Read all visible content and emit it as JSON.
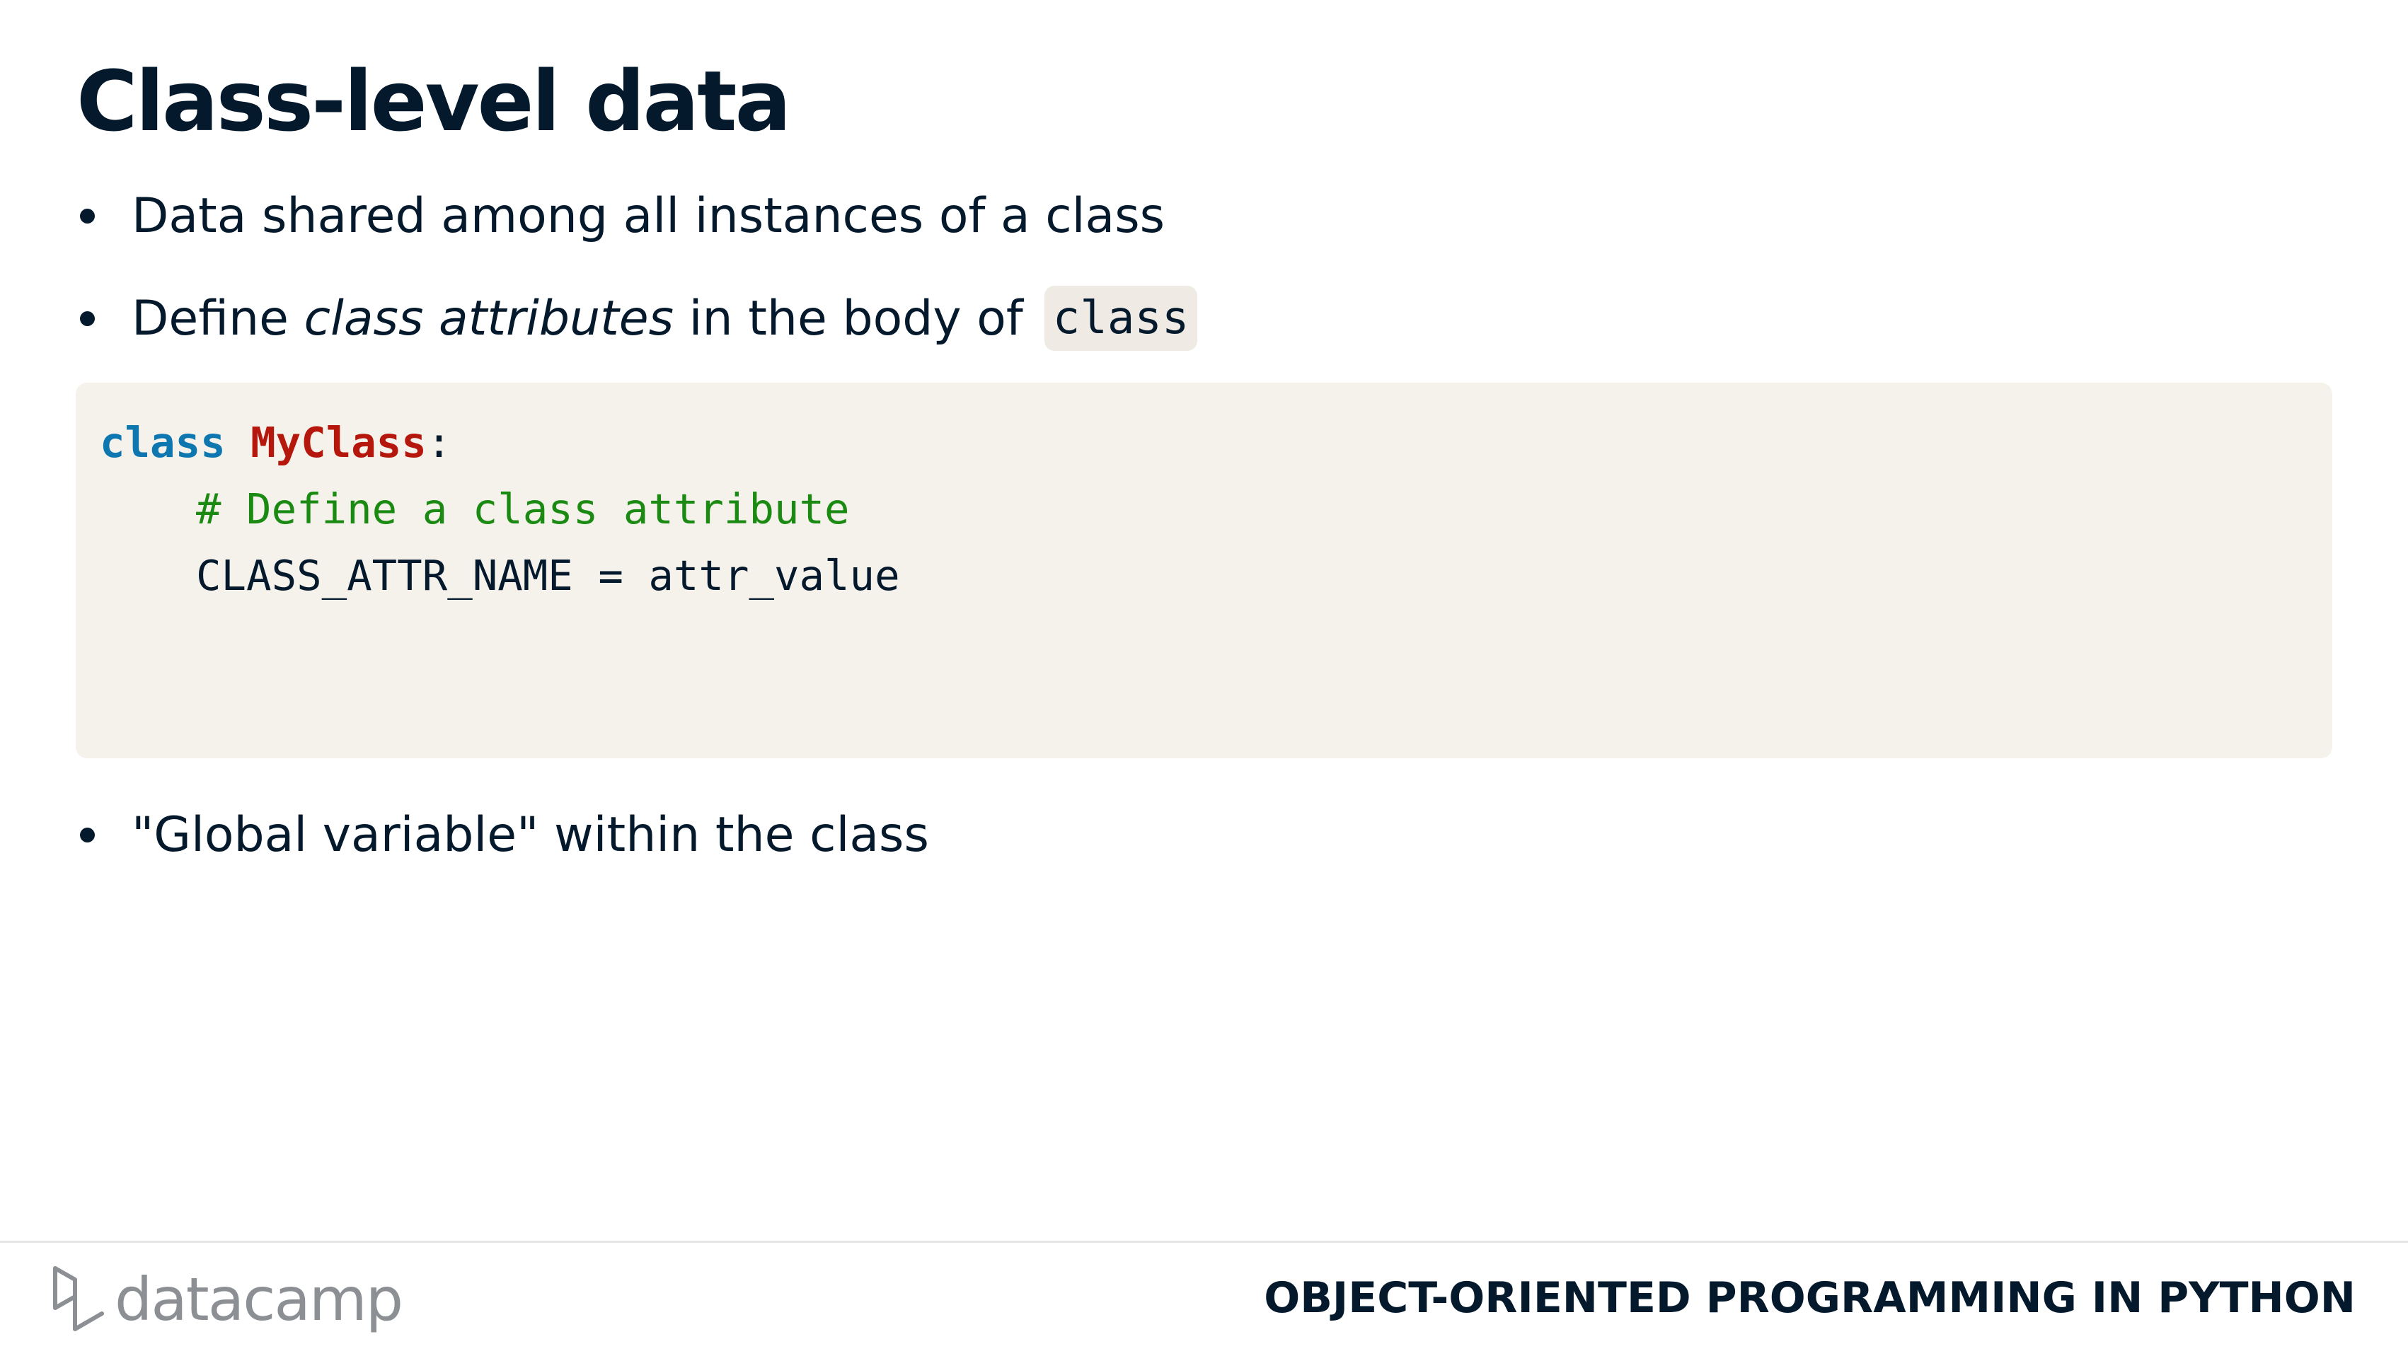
{
  "slide": {
    "title": "Class-level data",
    "bullets": [
      {
        "text": "Data shared among all instances of a class"
      },
      {
        "prefix": "Define ",
        "italic": "class attributes",
        "suffix": " in the body of",
        "code": "class"
      },
      {
        "text": "\"Global variable\" within the class"
      }
    ],
    "code": {
      "line1": {
        "keyword": "class",
        "class_name": "MyClass",
        "punct": ":"
      },
      "line2": {
        "comment": "# Define a class attribute"
      },
      "line3": {
        "statement": "CLASS_ATTR_NAME = attr_value"
      }
    }
  },
  "footer": {
    "logo_text": "datacamp",
    "course_title": "OBJECT-ORIENTED PROGRAMMING IN PYTHON"
  },
  "colors": {
    "text": "#05192d",
    "code_background": "#f5f2eb",
    "keyword": "#0e77b0",
    "class_name": "#b5170c",
    "comment": "#1a8a13",
    "logo_gray": "#8c8f94"
  }
}
